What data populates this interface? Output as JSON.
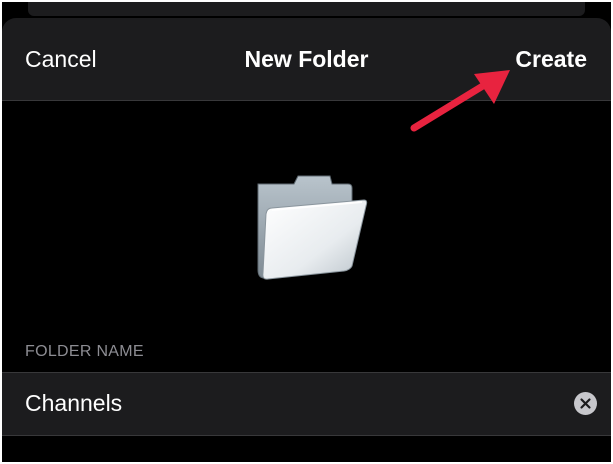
{
  "navbar": {
    "cancel_label": "Cancel",
    "title": "New Folder",
    "create_label": "Create"
  },
  "icons": {
    "folder": "folder-icon",
    "clear": "clear-text-icon",
    "annotation": "red-arrow-annotation"
  },
  "form": {
    "section_label": "FOLDER NAME",
    "folder_name_value": "Channels"
  },
  "colors": {
    "background": "#000000",
    "bar": "#1c1c1e",
    "text": "#ffffff",
    "secondary_text": "#8d8d93",
    "annotation_arrow": "#e8233f"
  }
}
